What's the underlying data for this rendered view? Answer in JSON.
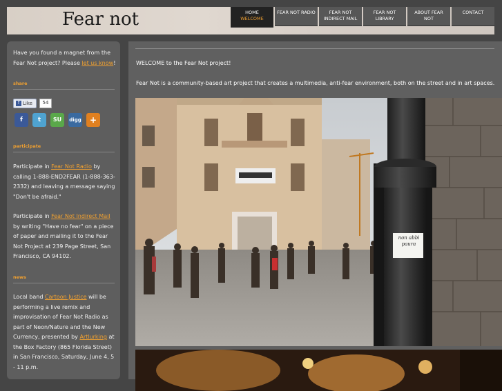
{
  "header": {
    "logo": "Fear not",
    "nav": [
      {
        "label": "HOME",
        "sub": "welcome",
        "active": true
      },
      {
        "label": "FEAR NOT RADIO",
        "sub": ""
      },
      {
        "label": "FEAR NOT",
        "sub": "INDIRECT MAIL"
      },
      {
        "label": "FEAR NOT",
        "sub": "LIBRARY"
      },
      {
        "label": "ABOUT FEAR",
        "sub": "NOT"
      },
      {
        "label": "CONTACT",
        "sub": ""
      }
    ]
  },
  "sidebar": {
    "intro_pre": "Have you found a magnet from the Fear Not project? Please ",
    "intro_link": "let us know",
    "intro_post": "!",
    "share_head": "share",
    "like_label": "Like",
    "like_count": "54",
    "share_icons": [
      {
        "name": "facebook",
        "glyph": "f",
        "color": "#3b5998"
      },
      {
        "name": "twitter",
        "glyph": "t",
        "color": "#4fa3d1"
      },
      {
        "name": "stumbleupon",
        "glyph": "SU",
        "color": "#5aa84a"
      },
      {
        "name": "digg",
        "glyph": "digg",
        "color": "#3a6aa0"
      },
      {
        "name": "more",
        "glyph": "+",
        "color": "#e08020"
      }
    ],
    "participate_head": "participate",
    "p1_pre": "Participate in ",
    "p1_link": "Fear Not Radio",
    "p1_post": " by calling 1-888-END2FEAR (1-888-363-2332) and leaving a message saying \"Don't be afraid.\"",
    "p2_pre": "Participate in ",
    "p2_link": "Fear Not Indirect Mail",
    "p2_post": " by writing \"Have no fear\" on a piece of paper and mailing it to the Fear Not Project at 239 Page Street, San Francisco, CA 94102.",
    "news_head": "news",
    "n1_pre": "Local band ",
    "n1_link": "Cartoon Justice",
    "n1_mid": " will be performing a live remix and improvisation of Fear Not Radio as part of Neon/Nature and the New Currency, presented by ",
    "n1_link2": "Artlurking",
    "n1_post": " at the Box Factory (865 Florida Street) in San Francisco, Saturday, June 4, 5 - 11 p.m."
  },
  "main": {
    "welcome": "WELCOME to the Fear Not project!",
    "intro": "Fear Not is a community-based art project that creates a multimedia, anti-fear environment, both on the street and in art spaces.",
    "note_text": "non abbi paura"
  }
}
